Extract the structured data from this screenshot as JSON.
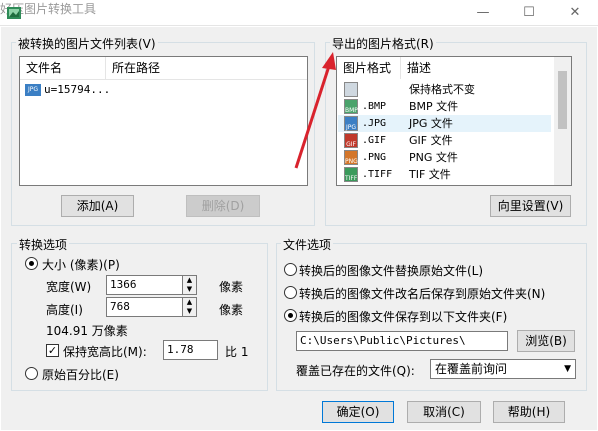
{
  "window": {
    "title": "好压图片转换工具",
    "minimize": "—",
    "maximize": "☐",
    "close": "✕"
  },
  "left_group": {
    "title": "被转换的图片文件列表(V)",
    "columns": [
      "文件名",
      "所在路径"
    ],
    "files": [
      {
        "badge": "JPG",
        "name": "u=15794...",
        "path": ""
      }
    ],
    "add_label": "添加(A)",
    "delete_label": "删除(D)"
  },
  "right_group": {
    "title": "导出的图片格式(R)",
    "columns": [
      "图片格式",
      "描述"
    ],
    "formats": [
      {
        "badge": "",
        "name": "",
        "desc": "保持格式不变",
        "color": "#cfd8e0"
      },
      {
        "badge": "BMP",
        "name": ".BMP",
        "desc": "BMP 文件",
        "color": "#4aa36b"
      },
      {
        "badge": "JPG",
        "name": ".JPG",
        "desc": "JPG 文件",
        "color": "#3b7fc4"
      },
      {
        "badge": "GIF",
        "name": ".GIF",
        "desc": "GIF 文件",
        "color": "#c0392b"
      },
      {
        "badge": "PNG",
        "name": ".PNG",
        "desc": "PNG 文件",
        "color": "#d4762a"
      },
      {
        "badge": "TIFF",
        "name": ".TIFF",
        "desc": "TIF 文件",
        "color": "#3a9a5b"
      }
    ],
    "selected_index": 2,
    "wizard_label": "向里设置(V)"
  },
  "convert_group": {
    "title": "转换选项",
    "size_option": "大小 (像素)(P)",
    "width_label": "宽度(W)",
    "width_value": "1366",
    "height_label": "高度(I)",
    "height_value": "768",
    "pixel_unit": "像素",
    "megapixels": "104.91 万像素",
    "keep_ratio_label": "保持宽高比(M):",
    "ratio_value": "1.78",
    "ratio_suffix": "比 1",
    "percent_option": "原始百分比(E)"
  },
  "file_group": {
    "title": "文件选项",
    "option_replace": "转换后的图像文件替换原始文件(L)",
    "option_rename": "转换后的图像文件改名后保存到原始文件夹(N)",
    "option_save": "转换后的图像文件保存到以下文件夹(F)",
    "folder_path": "C:\\Users\\Public\\Pictures\\",
    "browse_label": "浏览(B)",
    "overwrite_label": "覆盖已存在的文件(Q):",
    "overwrite_value": "在覆盖前询问"
  },
  "footer": {
    "ok": "确定(O)",
    "cancel": "取消(C)",
    "help": "帮助(H)"
  },
  "annotation": {
    "arrow_color": "#d9232d"
  }
}
